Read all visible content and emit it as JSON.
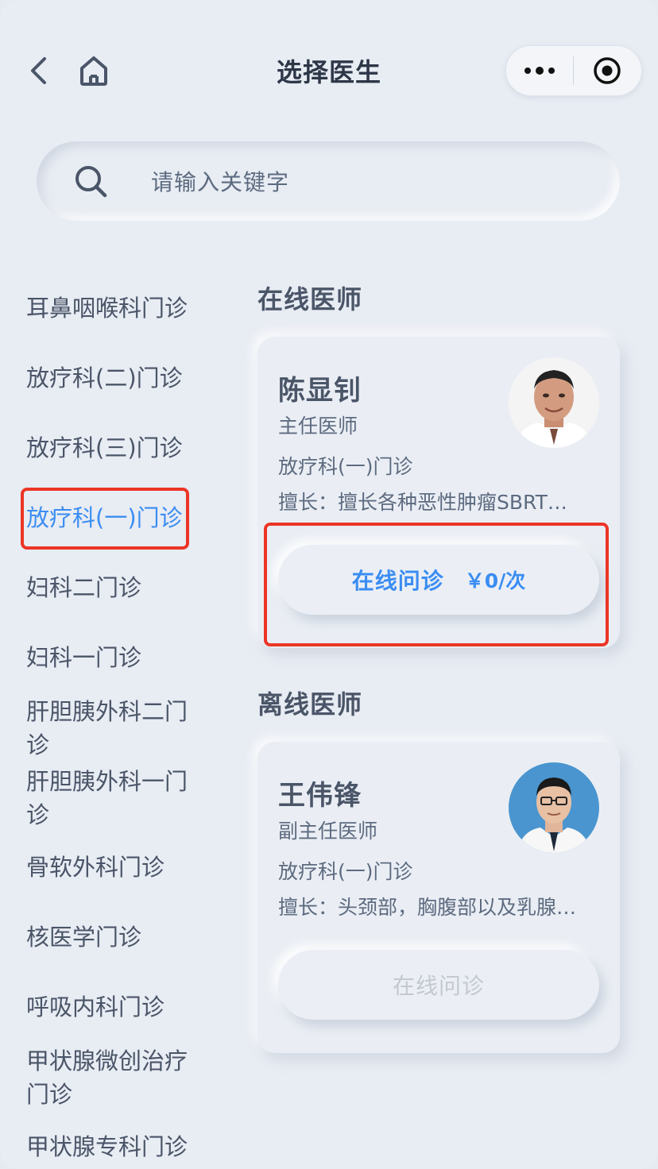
{
  "header": {
    "title": "选择医生"
  },
  "search": {
    "placeholder": "请输入关键字"
  },
  "sidebar": {
    "items": [
      {
        "label": "耳鼻咽喉科门诊"
      },
      {
        "label": "放疗科(二)门诊"
      },
      {
        "label": "放疗科(三)门诊"
      },
      {
        "label": "放疗科(一)门诊",
        "active": true
      },
      {
        "label": "妇科二门诊"
      },
      {
        "label": "妇科一门诊"
      },
      {
        "label": "肝胆胰外科二门诊"
      },
      {
        "label": "肝胆胰外科一门诊"
      },
      {
        "label": "骨软外科门诊"
      },
      {
        "label": "核医学门诊"
      },
      {
        "label": "呼吸内科门诊"
      },
      {
        "label": "甲状腺微创治疗门诊"
      },
      {
        "label": "甲状腺专科门诊"
      }
    ]
  },
  "online": {
    "section_title": "在线医师",
    "doctor": {
      "name": "陈显钊",
      "title": "主任医师",
      "dept": "放疗科(一)门诊",
      "specialty": "擅长：擅长各种恶性肿瘤SBRT…",
      "button_label": "在线问诊",
      "price": "￥0/次"
    }
  },
  "offline": {
    "section_title": "离线医师",
    "doctor": {
      "name": "王伟锋",
      "title": "副主任医师",
      "dept": "放疗科(一)门诊",
      "specialty": "擅长：头颈部，胸腹部以及乳腺…",
      "button_label": "在线问诊"
    }
  },
  "colors": {
    "accent": "#3b8df2",
    "highlight": "#ec3526",
    "disabled": "#c3c8d1"
  }
}
